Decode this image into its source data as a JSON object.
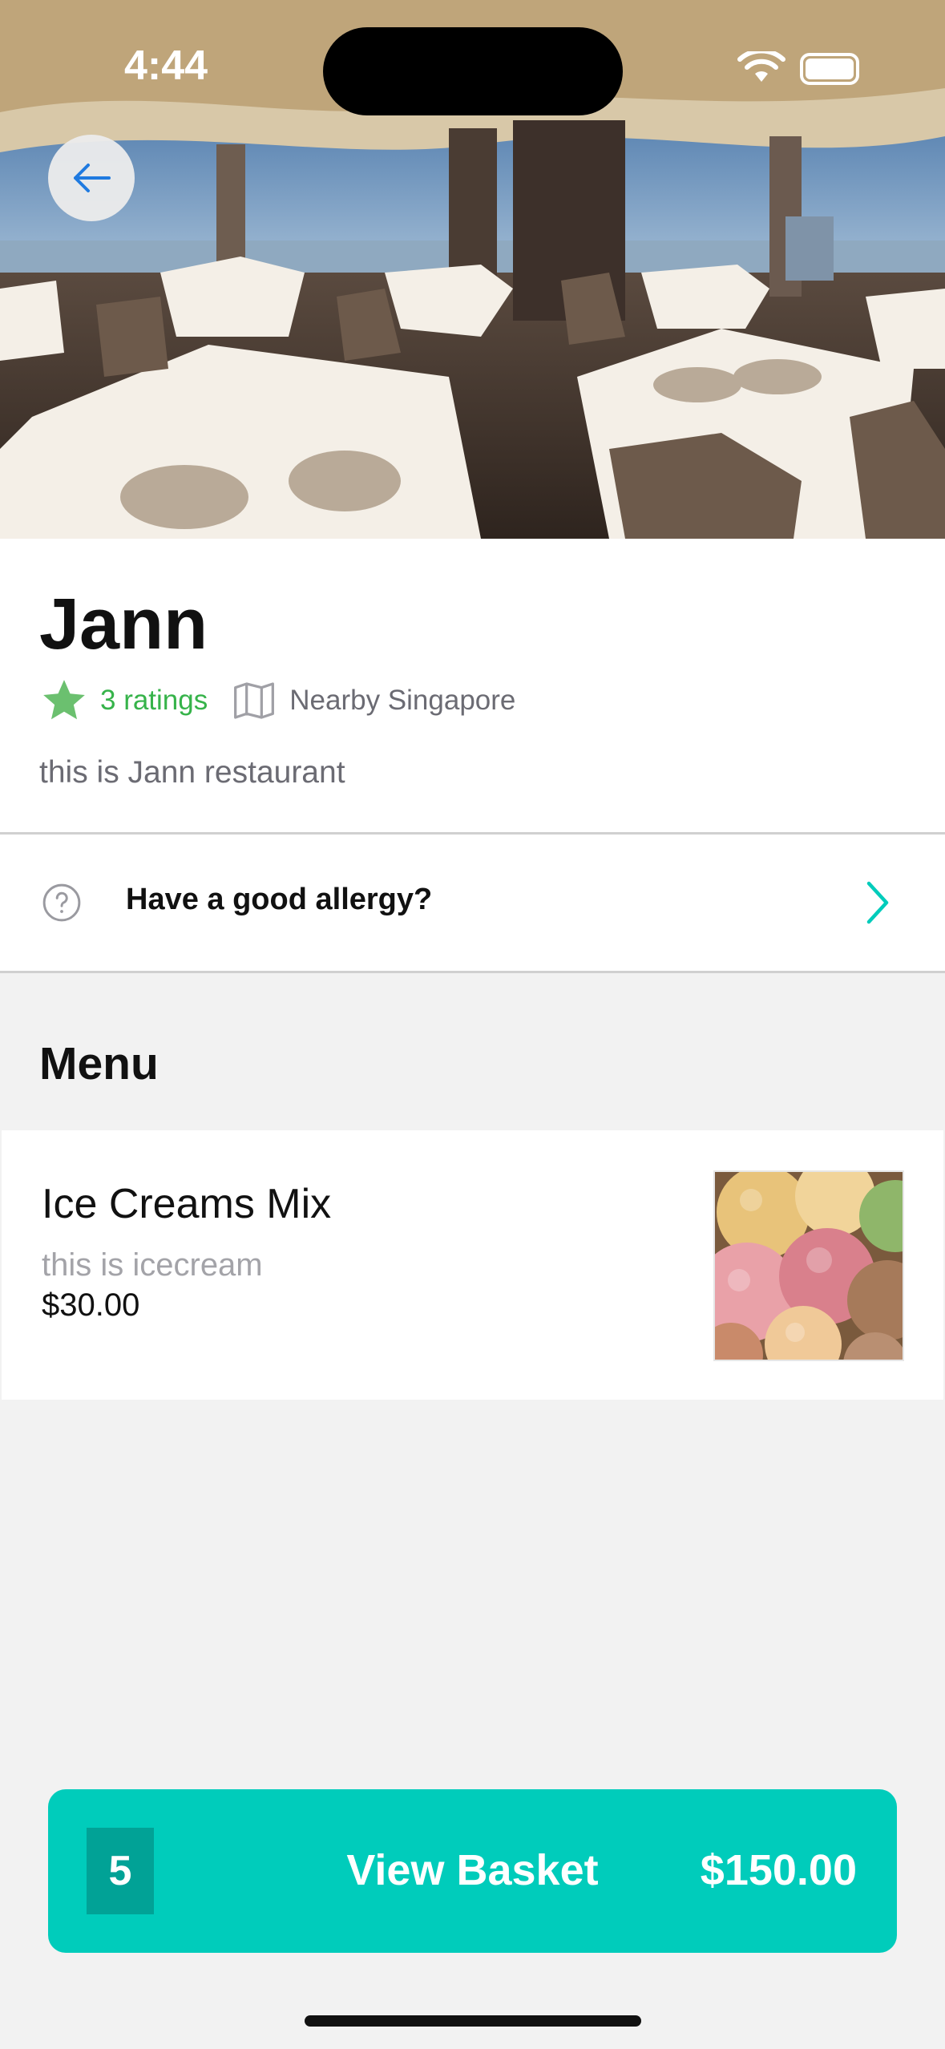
{
  "status_bar": {
    "time": "4:44"
  },
  "hero": {
    "image_alt": "restaurant dining room photo"
  },
  "restaurant": {
    "name": "Jann",
    "ratings": "3 ratings",
    "location": "Nearby Singapore",
    "description": "this is Jann restaurant"
  },
  "allergy_row": {
    "label": "Have a good allergy?"
  },
  "menu": {
    "title": "Menu",
    "items": [
      {
        "name": "Ice Creams Mix",
        "description": "this is icecream",
        "price": "$30.00"
      }
    ]
  },
  "basket": {
    "count": "5",
    "label": "View Basket",
    "total": "$150.00"
  },
  "colors": {
    "accent": "#00ccbb",
    "accent_dark": "#01a296",
    "rating_green": "#36b34a",
    "back_arrow": "#1f7ae0"
  },
  "icons": [
    "back-arrow-icon",
    "star-icon",
    "map-icon",
    "question-circle-icon",
    "chevron-right-icon",
    "wifi-icon",
    "battery-icon"
  ]
}
